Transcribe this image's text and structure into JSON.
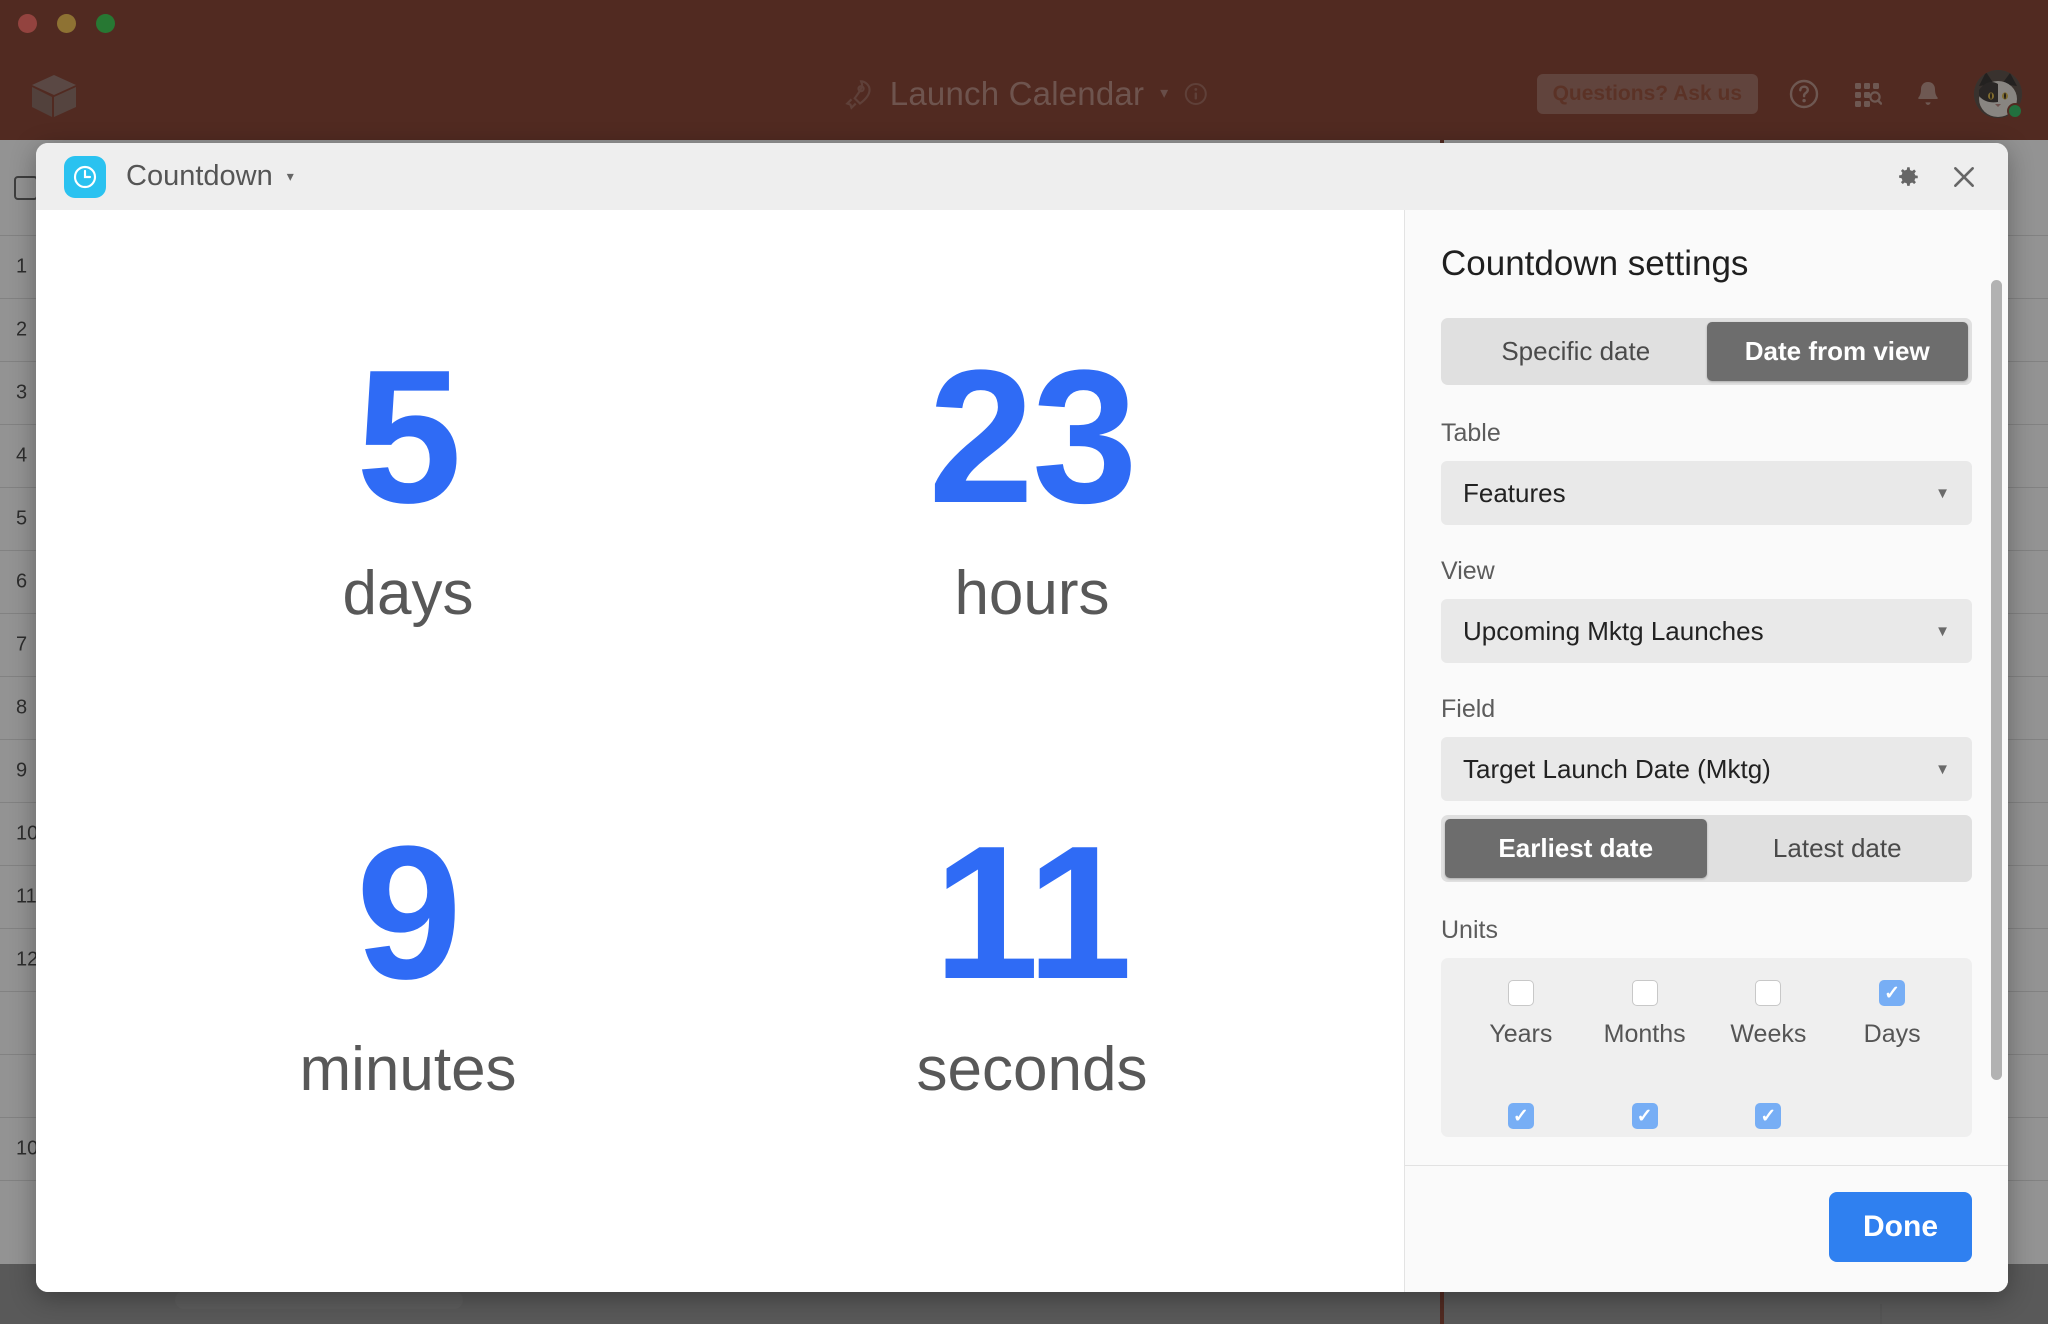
{
  "window": {
    "traffic_lights": [
      "close",
      "minimize",
      "maximize"
    ]
  },
  "appbar": {
    "logo_icon": "airtable-cube-icon",
    "rocket_icon": "rocket-icon",
    "title": "Launch Calendar",
    "title_caret": "▾",
    "info_icon": "info-icon",
    "ask_us_label": "Questions? Ask us",
    "help_icon": "help-circle-icon",
    "apps_icon": "apps-search-icon",
    "bell_icon": "bell-icon",
    "avatar_icon": "user-avatar",
    "status": "online",
    "colors": {
      "bar_background": "#7b2d1a",
      "title_text": "#b58074",
      "status_dot": "#1cb954"
    }
  },
  "modal": {
    "app_icon": "clock-icon",
    "title": "Countdown",
    "title_caret": "▾",
    "settings_icon": "gear-icon",
    "close_icon": "close-icon"
  },
  "countdown": {
    "units": [
      {
        "value": "5",
        "label": "days"
      },
      {
        "value": "23",
        "label": "hours"
      },
      {
        "value": "9",
        "label": "minutes"
      },
      {
        "value": "11",
        "label": "seconds"
      }
    ],
    "value_color": "#2f6bf5",
    "label_color": "#585858"
  },
  "settings": {
    "title": "Countdown settings",
    "source_mode": {
      "options": [
        "Specific date",
        "Date from view"
      ],
      "selected": "Date from view"
    },
    "table": {
      "label": "Table",
      "value": "Features",
      "caret": "▼"
    },
    "view": {
      "label": "View",
      "value": "Upcoming Mktg Launches",
      "caret": "▼"
    },
    "field": {
      "label": "Field",
      "value": "Target Launch Date (Mktg)",
      "caret": "▼"
    },
    "date_pick": {
      "options": [
        "Earliest date",
        "Latest date"
      ],
      "selected": "Earliest date"
    },
    "units": {
      "label": "Units",
      "row1": [
        {
          "label": "Years",
          "checked": false
        },
        {
          "label": "Months",
          "checked": false
        },
        {
          "label": "Weeks",
          "checked": false
        },
        {
          "label": "Days",
          "checked": true
        }
      ],
      "row2": [
        {
          "label": "",
          "checked": true
        },
        {
          "label": "",
          "checked": true
        },
        {
          "label": "",
          "checked": true
        }
      ]
    },
    "done_label": "Done",
    "colors": {
      "accent": "#2f80f0",
      "checkbox_checked": "#77aef5",
      "segment_active": "#6d6d6d"
    }
  },
  "background_grid": {
    "row_numbers": [
      "1",
      "2",
      "3",
      "4",
      "5",
      "6",
      "7",
      "8",
      "9",
      "10",
      "11",
      "12",
      "",
      "",
      "10"
    ]
  }
}
